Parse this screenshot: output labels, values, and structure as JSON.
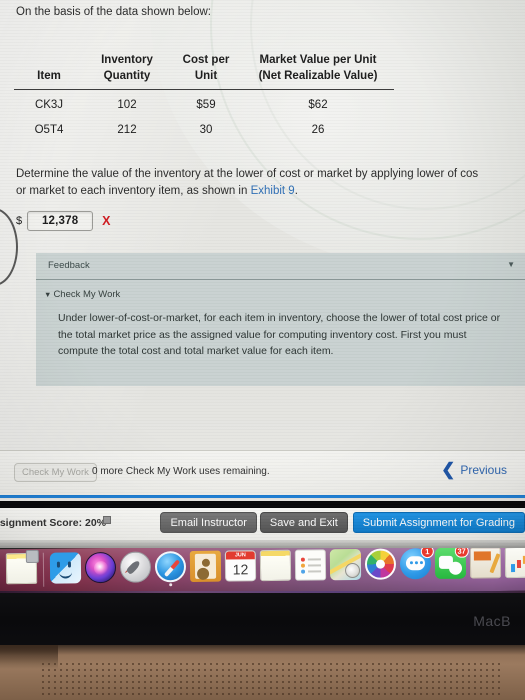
{
  "question": {
    "intro": "On the basis of the data shown below:",
    "prompt_line1": "Determine the value of the inventory at the lower of cost or market by applying lower of cos",
    "prompt_line2_a": "or market to each inventory item, as shown in ",
    "prompt_link": "Exhibit 9",
    "prompt_line2_b": "."
  },
  "table": {
    "headers_top": [
      "",
      "Inventory",
      "Cost per",
      "Market Value per Unit"
    ],
    "headers_bottom": [
      "Item",
      "Quantity",
      "Unit",
      "(Net Realizable Value)"
    ],
    "rows": [
      {
        "item": "CK3J",
        "quantity": "102",
        "cost_per_unit": "$59",
        "market_value": "$62"
      },
      {
        "item": "O5T4",
        "quantity": "212",
        "cost_per_unit": "30",
        "market_value": "26"
      }
    ]
  },
  "answer": {
    "currency_symbol": "$",
    "value": "12,378",
    "status_mark": "X",
    "status_color": "#cf1a20"
  },
  "feedback": {
    "title": "Feedback",
    "collapse_icon": "▼",
    "check_my_work_label": "Check My Work",
    "check_my_work_caret": "▼",
    "body": "Under lower-of-cost-or-market, for each item in inventory, choose the lower of total cost price or the total market price as the assigned value for computing inventory cost. First you must compute the total cost and total market value for each item."
  },
  "check_bar": {
    "button_label": "Check My Work",
    "uses_remaining_text": "0 more Check My Work uses remaining.",
    "previous_label": "Previous",
    "previous_icon": "❮",
    "accent_color": "#1f7fd4"
  },
  "assignment_bar": {
    "score_label": "ssignment Score: 20%",
    "email_instructor": "Email Instructor",
    "save_and_exit": "Save and Exit",
    "submit_label": "Submit Assignment for Grading",
    "submit_color": "#1689dd"
  },
  "dock": {
    "items": [
      {
        "name": "stickies",
        "label": "Stickies",
        "badge": "",
        "running": false
      },
      {
        "name": "finder",
        "label": "Finder",
        "badge": "",
        "running": true
      },
      {
        "name": "siri",
        "label": "Siri",
        "badge": "",
        "running": false
      },
      {
        "name": "launchpad",
        "label": "Launchpad",
        "badge": "",
        "running": false
      },
      {
        "name": "safari",
        "label": "Safari",
        "badge": "",
        "running": true
      },
      {
        "name": "contacts",
        "label": "Contacts",
        "badge": "",
        "running": false
      },
      {
        "name": "calendar",
        "label": "Calendar",
        "badge": "",
        "running": false,
        "cal_month": "JUN",
        "cal_day": "12"
      },
      {
        "name": "notes",
        "label": "Notes",
        "badge": "",
        "running": false
      },
      {
        "name": "reminders",
        "label": "Reminders",
        "badge": "",
        "running": false
      },
      {
        "name": "maps",
        "label": "Maps",
        "badge": "",
        "running": false
      },
      {
        "name": "photos",
        "label": "Photos",
        "badge": "",
        "running": false
      },
      {
        "name": "messages",
        "label": "Messages",
        "badge": "1",
        "running": false
      },
      {
        "name": "facetime",
        "label": "FaceTime",
        "badge": "37",
        "running": false
      },
      {
        "name": "pages",
        "label": "Pages",
        "badge": "",
        "running": false
      },
      {
        "name": "numbers",
        "label": "Numbers",
        "badge": "",
        "running": false
      }
    ]
  },
  "device": {
    "brand_text": "MacB"
  }
}
